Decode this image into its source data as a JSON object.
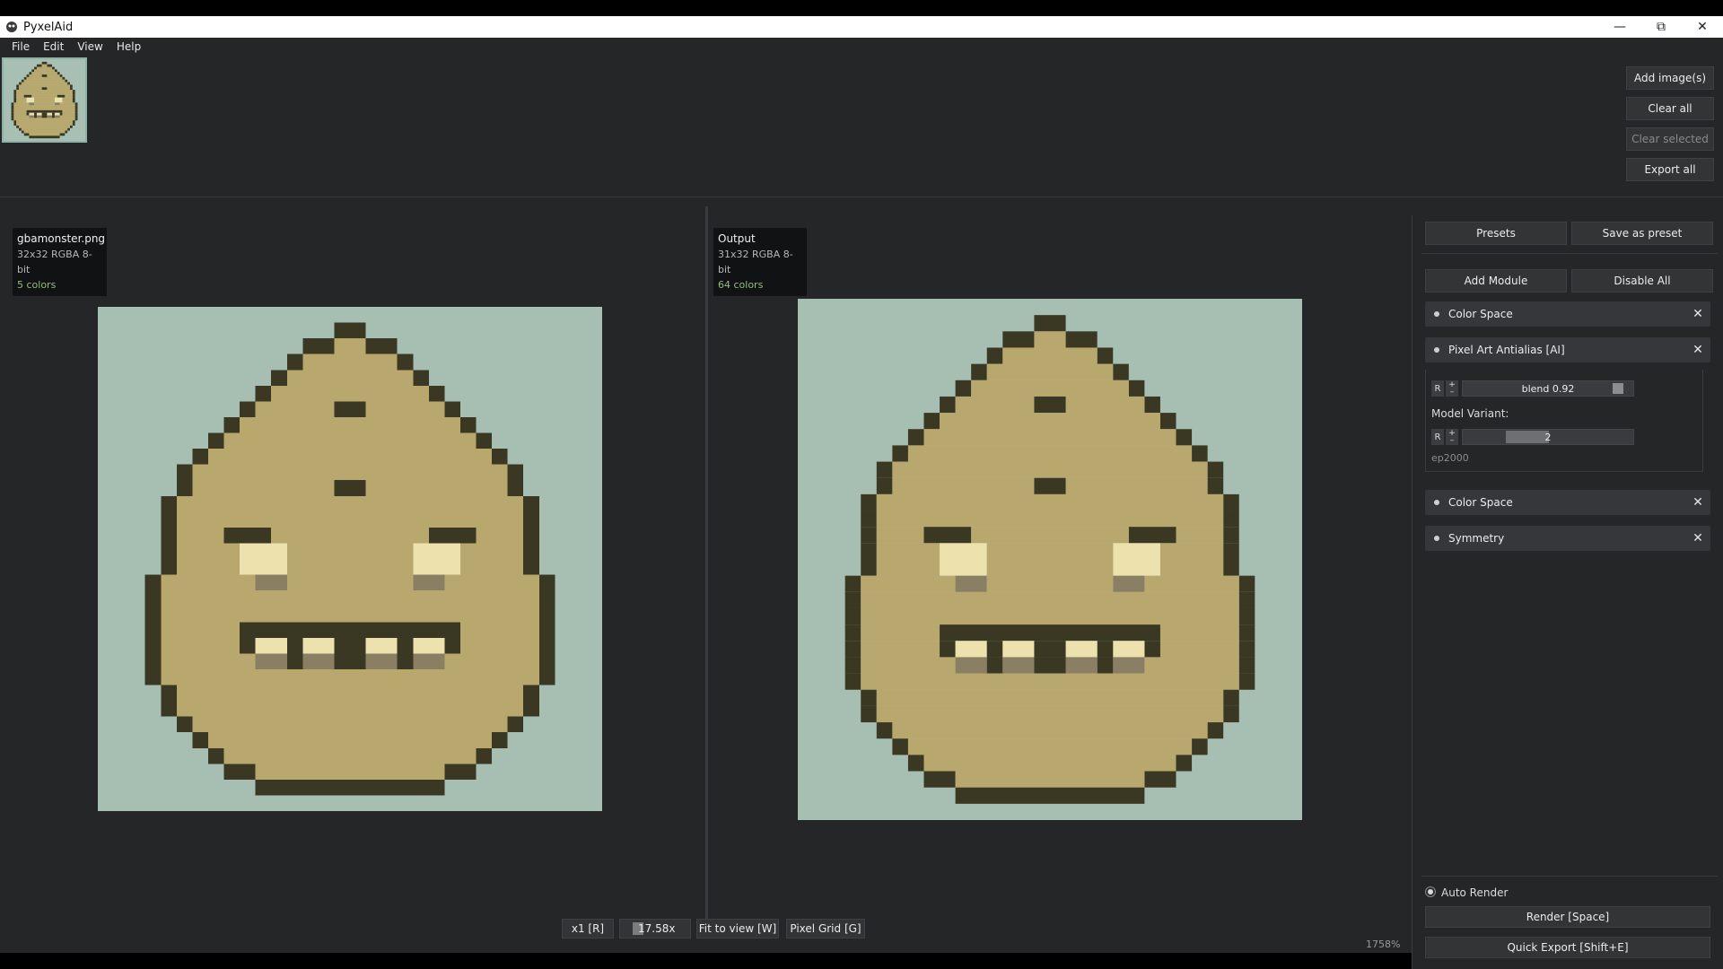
{
  "window": {
    "title": "PyxelAid"
  },
  "menu": [
    "File",
    "Edit",
    "View",
    "Help"
  ],
  "top_buttons": {
    "add": "Add image(s)",
    "clear_all": "Clear all",
    "clear_selected": "Clear selected",
    "export_all": "Export all"
  },
  "input_info": {
    "name": "gbamonster.png",
    "meta": "32x32  RGBA  8-bit",
    "colors": "5 colors"
  },
  "output_info": {
    "name": "Output",
    "meta": "31x32  RGBA  8-bit",
    "colors": "64 colors"
  },
  "toolbar": {
    "x1": "x1 [R]",
    "zoom": "17.58x",
    "fit": "Fit to view [W]",
    "grid": "Pixel Grid [G]",
    "zoom_pct": "1758%"
  },
  "panel": {
    "presets": "Presets",
    "save_preset": "Save as preset",
    "add_module": "Add Module",
    "disable_all": "Disable All",
    "modules": [
      "Color Space",
      "Pixel Art Antialias [AI]",
      "Color Space",
      "Symmetry"
    ],
    "aa": {
      "blend_label": "blend 0.92",
      "blend_value": 0.92,
      "variant_label": "Model Variant:",
      "variant_value": "2",
      "variant_sub": "ep2000",
      "reset": "R",
      "plus": "+",
      "minus": "–"
    },
    "auto_render": "Auto Render",
    "render": "Render  [Space]",
    "quick_export": "Quick Export  [Shift+E]"
  },
  "colors": {
    "bg": "#a7bfb3",
    "dark": "#3a3823",
    "body": "#b8a86e",
    "shade": "#8a7f62",
    "light": "#ede1ad",
    "accent": "#8fbf7a"
  }
}
